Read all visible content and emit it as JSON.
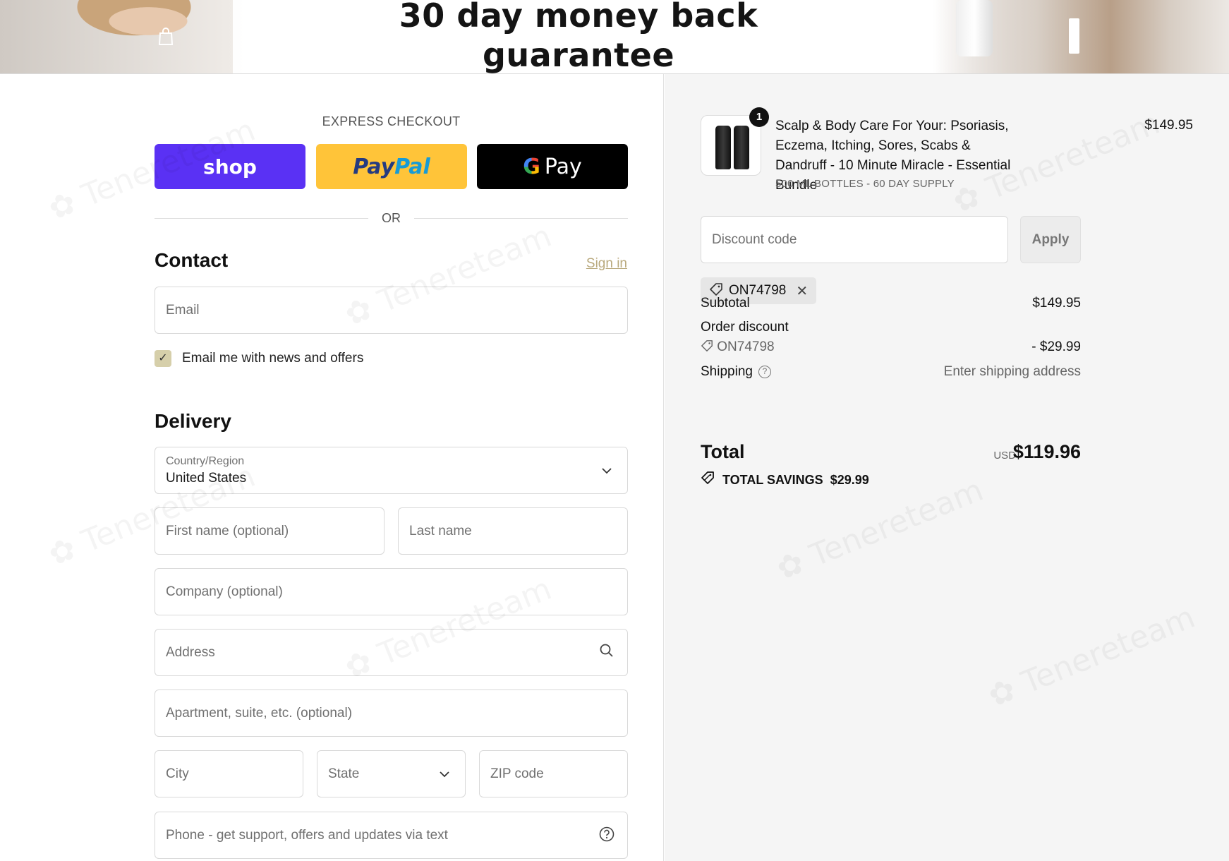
{
  "banner": {
    "title": "30 day money back guarantee",
    "bag_icon": "shopping-bag-icon",
    "menu_icon": "menu-icon"
  },
  "express": {
    "title": "EXPRESS CHECKOUT",
    "shop_label": "shop",
    "paypal_label_1": "Pay",
    "paypal_label_2": "Pal",
    "gpay_g": "G",
    "gpay_label": "Pay",
    "or_label": "OR"
  },
  "contact": {
    "title": "Contact",
    "signin_label": "Sign in",
    "email_placeholder": "Email",
    "newsletter_label": "Email me with news and offers",
    "newsletter_checked": true
  },
  "delivery": {
    "title": "Delivery",
    "country_label": "Country/Region",
    "country_value": "United States",
    "first_name_placeholder": "First name (optional)",
    "last_name_placeholder": "Last name",
    "company_placeholder": "Company (optional)",
    "address_placeholder": "Address",
    "apartment_placeholder": "Apartment, suite, etc. (optional)",
    "city_placeholder": "City",
    "state_placeholder": "State",
    "zip_placeholder": "ZIP code",
    "phone_placeholder": "Phone - get support, offers and updates via text"
  },
  "order": {
    "product": {
      "quantity": "1",
      "name": "Scalp & Body Care For Your: Psoriasis, Eczema, Itching, Sores, Scabs & Dandruff - 10 Minute Miracle - Essential Bundle",
      "variant": "500 ML BOTTLES - 60 DAY SUPPLY",
      "price": "$149.95"
    },
    "discount_placeholder": "Discount code",
    "apply_label": "Apply",
    "applied_code": "ON74798",
    "subtotal_label": "Subtotal",
    "subtotal_value": "$149.95",
    "order_discount_label": "Order discount",
    "order_discount_code": "ON74798",
    "order_discount_value": "- $29.99",
    "shipping_label": "Shipping",
    "shipping_value": "Enter shipping address",
    "total_label": "Total",
    "total_currency": "USD",
    "total_value": "$119.96",
    "savings_label": "TOTAL SAVINGS",
    "savings_value": "$29.99"
  },
  "colors": {
    "shop_purple": "#5a31f4",
    "paypal_yellow": "#ffc439",
    "gpay_black": "#000000",
    "signin_link": "#b9a97d",
    "checkbox_fill": "#d6cfaa"
  }
}
